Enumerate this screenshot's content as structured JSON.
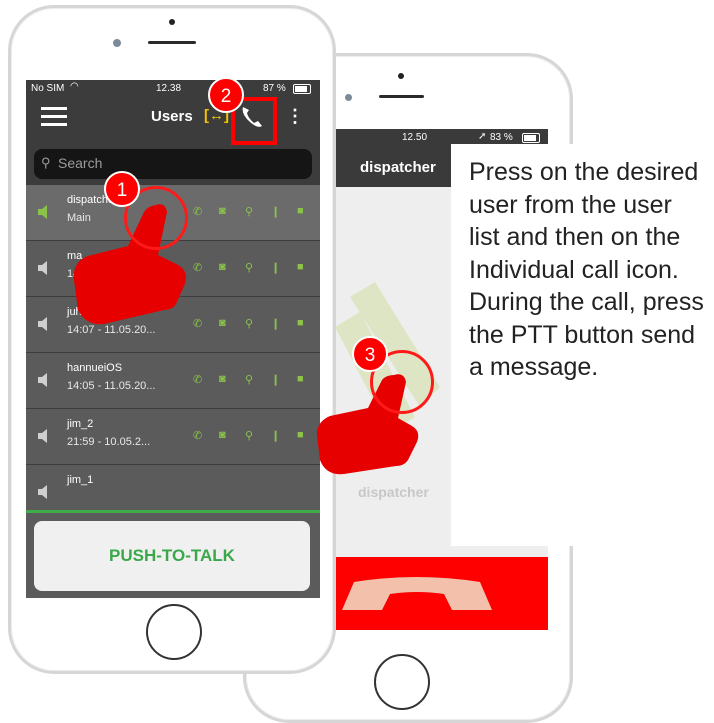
{
  "back_phone": {
    "status_time": "12.50",
    "status_battery": "83 %",
    "header_title": "dispatcher",
    "watermark_label": "dispatcher"
  },
  "front_phone": {
    "status_carrier": "No SIM",
    "status_time": "12.38",
    "status_battery": "87 %",
    "nav_title": "Users",
    "search_placeholder": "Search",
    "users": [
      {
        "name": "dispatcher",
        "sub": "Main",
        "selected": true
      },
      {
        "name": "ma",
        "sub": "14:... - ...20..."
      },
      {
        "name": "juha",
        "sub": "14:07 - 11.05.20..."
      },
      {
        "name": "hannueiOS",
        "sub": "14:05 - 11.05.20..."
      },
      {
        "name": "jim_2",
        "sub": "21:59 - 10.05.2..."
      },
      {
        "name": "jim_1",
        "sub": ""
      }
    ],
    "ptt_label": "PUSH-TO-TALK"
  },
  "markers": {
    "step1": "1",
    "step2": "2",
    "step3": "3"
  },
  "callout_text": "Press on the desired user from the user list and then on the Individual call icon. During the call, press the PTT button send a message.",
  "colors": {
    "accent_green": "#3aa84a",
    "icon_green": "#8bc34a",
    "marker_red": "#ff0000",
    "screen_gray": "#5b5b5b",
    "bar_dark": "#3c3c3c"
  }
}
